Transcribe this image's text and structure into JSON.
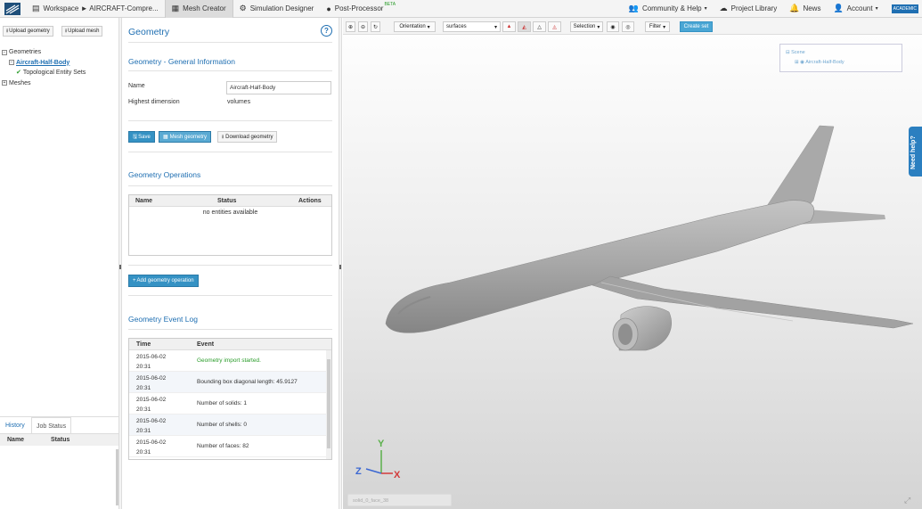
{
  "topbar": {
    "workspace": "Workspace ► AIRCRAFT-Compre...",
    "mesh_creator": "Mesh Creator",
    "simulation_designer": "Simulation Designer",
    "post_processor": "Post-Processor",
    "beta": "BETA",
    "community": "Community & Help",
    "project_library": "Project Library",
    "news": "News",
    "account": "Account",
    "academic": "ACADEMIC"
  },
  "left": {
    "upload_geometry": "Upload geometry",
    "upload_mesh": "Upload mesh",
    "tree": {
      "geometries": "Geometries",
      "aircraft": "Aircraft-Half-Body",
      "tes": "Topological Entity Sets",
      "meshes": "Meshes"
    },
    "tabs": {
      "history": "History",
      "job_status": "Job Status"
    },
    "cols": {
      "name": "Name",
      "status": "Status"
    }
  },
  "mid": {
    "title": "Geometry",
    "general_title": "Geometry - General Information",
    "name_label": "Name",
    "name_value": "Aircraft-Half-Body",
    "dim_label": "Highest dimension",
    "dim_value": "volumes",
    "save": "Save",
    "mesh_geometry": "Mesh geometry",
    "download_geometry": "Download geometry",
    "ops_title": "Geometry Operations",
    "ops_cols": {
      "name": "Name",
      "status": "Status",
      "actions": "Actions"
    },
    "ops_empty": "no entities available",
    "add_op": "Add geometry operation",
    "log_title": "Geometry Event Log",
    "log_cols": {
      "time": "Time",
      "event": "Event"
    },
    "log": [
      {
        "date": "2015-06-02",
        "time": "20:31",
        "event": "Geometry import started."
      },
      {
        "date": "2015-06-02",
        "time": "20:31",
        "event": "Bounding box diagonal length: 45.9127"
      },
      {
        "date": "2015-06-02",
        "time": "20:31",
        "event": "Number of solids: 1"
      },
      {
        "date": "2015-06-02",
        "time": "20:31",
        "event": "Number of shells: 0"
      },
      {
        "date": "2015-06-02",
        "time": "20:31",
        "event": "Number of faces: 82"
      }
    ]
  },
  "viewer": {
    "orientation": "Orientation",
    "surfaces": "surfaces",
    "selection": "Selection",
    "filter": "Filter",
    "create_set": "Create set",
    "scene": "Scene",
    "scene_item": "Aircraft-Half-Body",
    "need_help": "Need help?",
    "status": "solid_0_face_38",
    "axis_x": "X",
    "axis_y": "Y",
    "axis_z": "Z"
  }
}
